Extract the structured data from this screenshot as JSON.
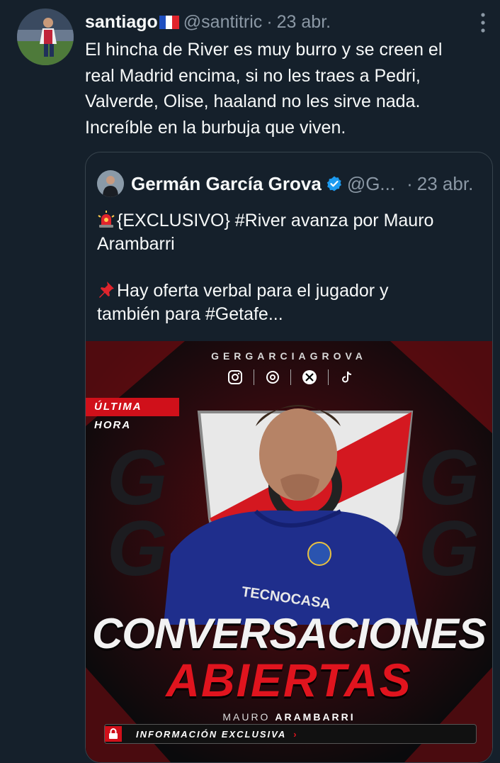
{
  "tweet": {
    "author_name": "santiago",
    "author_flag": "france-flag-icon",
    "handle": "@santitric",
    "separator": "·",
    "date": "23 abr.",
    "text_lines": [
      "El hincha de River es muy burro y se creen el",
      "real Madrid encima, si no les traes a Pedri,",
      "Valverde, Olise, haaland no les sirve nada.",
      "Increíble en la burbuja que viven."
    ]
  },
  "quote": {
    "author_name": "Germán García Grova",
    "handle": "@G...",
    "separator": "·",
    "date": "23 abr.",
    "line1": "{EXCLUSIVO} #River avanza por Mauro",
    "line2": "Arambarri",
    "line3": "Hay oferta verbal para el jugador y",
    "line4": "también para #Getafe...",
    "emoji1": "rotating-light-icon",
    "emoji2": "pushpin-icon"
  },
  "media": {
    "brand": "GERGARCIAGROVA",
    "ribbon": "ÚLTIMA HORA",
    "headline1": "CONVERSACIONES",
    "headline2": "ABIERTAS",
    "player_first": "MAURO",
    "player_last": "ARAMBARRI",
    "info_bar": "INFORMACIÓN EXCLUSIVA",
    "jersey_sponsor": "TECNOCASA",
    "socials": [
      "instagram-icon",
      "threads-icon",
      "x-icon",
      "tiktok-icon"
    ],
    "colors": {
      "accent_red": "#e0141e",
      "dark": "#0a0a0c"
    }
  },
  "theme": {
    "background": "#15202b",
    "text": "#f7f9f9",
    "muted": "#8b98a5",
    "border": "#38444d",
    "verified": "#1d9bf0"
  }
}
